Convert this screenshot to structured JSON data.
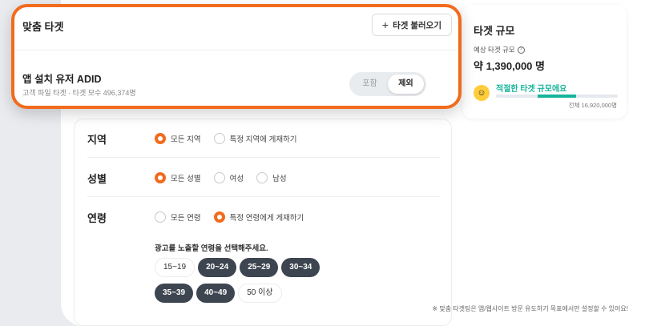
{
  "target_card": {
    "title": "맞춤 타겟",
    "load_button": "타겟 불러오기",
    "audience_name": "앱 설치 유저 ADID",
    "audience_meta": "고객 파일 타겟 · 타겟 모수 496,374명",
    "toggle": {
      "include": "포함",
      "exclude": "제외",
      "selected": "제외"
    }
  },
  "size_panel": {
    "title": "타겟 규모",
    "estimate_label": "예상 타겟 규모",
    "estimate_value": "약 1,390,000 명",
    "fit_label": "적절한 타겟 규모에요",
    "bar": {
      "fit_range_start": 0.34,
      "fit_range_end": 0.66
    },
    "total": "전체 16,920,000명",
    "accent_color": "#17b49b"
  },
  "form": {
    "region": {
      "label": "지역",
      "options": [
        "모든 지역",
        "특정 지역에 게재하기"
      ],
      "selected": 0
    },
    "gender": {
      "label": "성별",
      "options": [
        "모든 성별",
        "여성",
        "남성"
      ],
      "selected": 0
    },
    "age": {
      "label": "연령",
      "options": [
        "모든 연령",
        "특정 연령에게 게재하기"
      ],
      "selected": 1,
      "helper": "광고를 노출할 연령을 선택해주세요.",
      "chips": [
        {
          "label": "15~19",
          "selected": false
        },
        {
          "label": "20~24",
          "selected": true
        },
        {
          "label": "25~29",
          "selected": true
        },
        {
          "label": "30~34",
          "selected": true
        },
        {
          "label": "35~39",
          "selected": true
        },
        {
          "label": "40~49",
          "selected": true
        },
        {
          "label": "50 이상",
          "selected": false
        }
      ]
    }
  },
  "footnote": "※ 맞춤 타겟팅은 앱/웹사이트 방문 유도하기 목표에서만 설정할 수 있어요!",
  "colors": {
    "highlight": "#f26b1d",
    "chip_selected": "#3d4550"
  }
}
